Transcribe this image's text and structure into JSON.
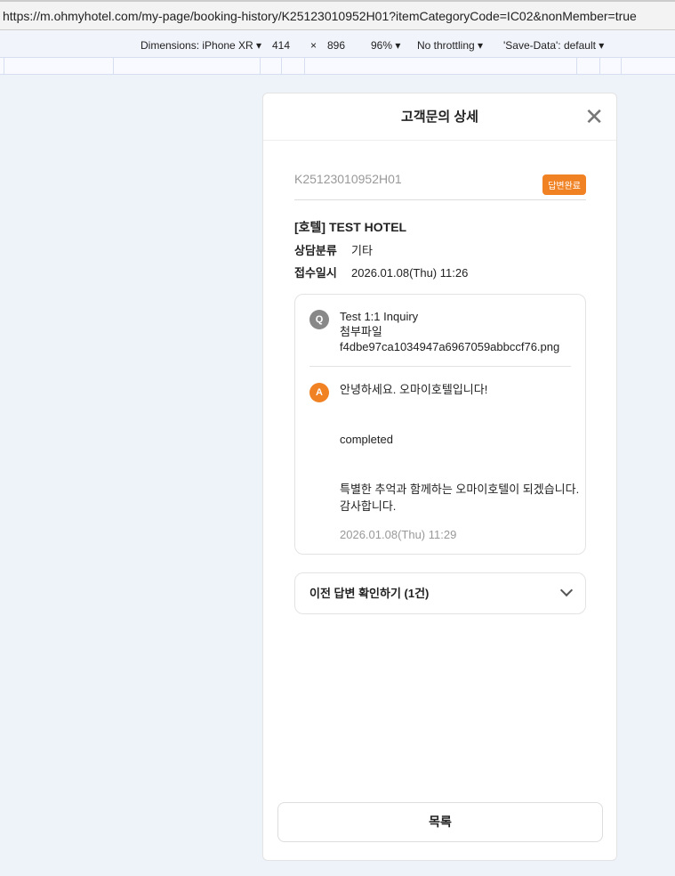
{
  "browser": {
    "url": "https://m.ohmyhotel.com/my-page/booking-history/K25123010952H01?itemCategoryCode=IC02&nonMember=true"
  },
  "devtools": {
    "dimensions": "Dimensions: iPhone XR ▾",
    "width": "414",
    "times": "×",
    "height": "896",
    "zoom": "96% ▾",
    "throttling": "No throttling ▾",
    "save_data": "'Save-Data': default ▾"
  },
  "modal": {
    "title": "고객문의 상세",
    "booking_id": "K25123010952H01",
    "status_badge": "답변완료",
    "hotel": "[호텔] TEST HOTEL",
    "category_label": "상담분류",
    "category_value": "기타",
    "date_label": "접수일시",
    "date_value": "2026.01.08(Thu) 11:26",
    "question": {
      "badge": "Q",
      "text": "Test 1:1 Inquiry",
      "attachment_label": "첨부파일",
      "attachment_file": "f4dbe97ca1034947a6967059abbccf76.png"
    },
    "answer": {
      "badge": "A",
      "greeting": "안녕하세요. 오마이호텔입니다!",
      "body": "completed",
      "closing1": "특별한 추억과 함께하는 오마이호텔이 되겠습니다.",
      "closing2": "감사합니다.",
      "date": "2026.01.08(Thu) 11:29"
    },
    "previous_answers": "이전 답변 확인하기 (1건)",
    "list_button": "목록"
  },
  "colors": {
    "accent": "#f08224"
  }
}
